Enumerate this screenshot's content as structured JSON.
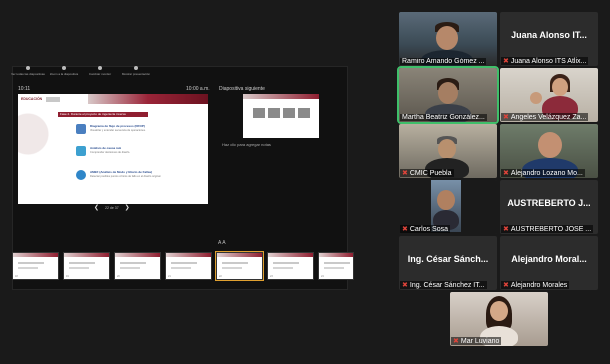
{
  "toolbar": {
    "items": [
      {
        "label": "Ver todas las diapositivas",
        "icon": "grid-icon"
      },
      {
        "label": "Zoom a la diapositiva",
        "icon": "zoom-icon"
      },
      {
        "label": "Cambiar monitor",
        "icon": "monitor-icon"
      },
      {
        "label": "Mostrar presentación",
        "icon": "presentation-icon"
      }
    ]
  },
  "presenter": {
    "timer": "10:11",
    "clock": "10:00 a.m.",
    "next_label": "Diapositiva siguiente",
    "notes_placeholder": "Haz clic para agregar notas",
    "slide_counter": "22 de 37",
    "main_slide": {
      "logo": "EDUCACIÓN",
      "title_bar": "Fase 2. Durante el proyecto de ingeniería inversa",
      "rows": [
        {
          "heading": "Diagrama de flujo de procesos (DFOP)",
          "body": "Visualizar y entender secuencia de operaciones."
        },
        {
          "heading": "Análisis de causa raíz",
          "body": "Comprender decisiones de diseño."
        },
        {
          "heading": "AMEF (Análisis de Modo y Efecto de Fallas)",
          "body": "Detectar posibles puntos críticos de fallo en el diseño original."
        }
      ]
    }
  },
  "thumbnails": [
    "18",
    "19",
    "20",
    "21",
    "22",
    "23",
    "24"
  ],
  "participants": [
    {
      "name": "Ramiro Amando Gómez ...",
      "muted": false,
      "video": true,
      "active": false
    },
    {
      "name": "Juana Alonso ITS Atlix...",
      "center": "Juana Alonso IT...",
      "muted": true,
      "video": false,
      "active": false
    },
    {
      "name": "Martha Beatriz González...",
      "muted": false,
      "video": true,
      "active": true
    },
    {
      "name": "Angeles Velázquez Za...",
      "muted": true,
      "video": true,
      "active": false
    },
    {
      "name": "CMIC Puebla",
      "muted": true,
      "video": true,
      "active": false
    },
    {
      "name": "Alejandro Lozano Mo...",
      "muted": true,
      "video": true,
      "active": false
    },
    {
      "name": "Carlos Sosa",
      "muted": true,
      "video": true,
      "active": false
    },
    {
      "name": "AUSTREBERTO JOSE ...",
      "center": "AUSTREBERTO J...",
      "muted": true,
      "video": false,
      "active": false
    },
    {
      "name": "Ing. César Sánchez IT...",
      "center": "Ing. César Sánch...",
      "muted": true,
      "video": false,
      "active": false
    },
    {
      "name": "Alejandro Morales",
      "center": "Alejandro Moral...",
      "muted": true,
      "video": false,
      "active": false
    },
    {
      "name": "Mar Luviano",
      "muted": true,
      "video": true,
      "active": false
    }
  ]
}
